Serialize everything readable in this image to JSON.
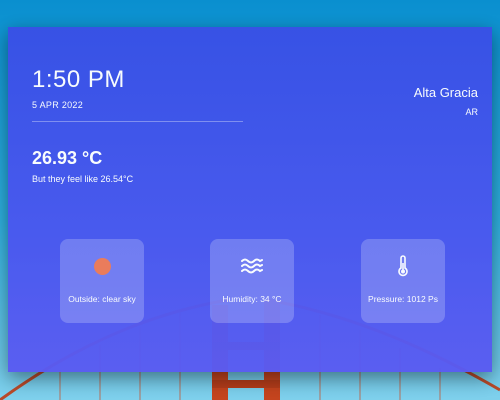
{
  "clock": {
    "time": "1:50 PM",
    "date": "5 APR 2022"
  },
  "location": {
    "city": "Alta Gracia",
    "country": "AR"
  },
  "weather": {
    "temperature": "26.93 °C",
    "feels_like": "But they feel like 26.54°C"
  },
  "tiles": [
    {
      "icon": "sun-icon",
      "label": "Outside: clear sky",
      "color": "#f07b58"
    },
    {
      "icon": "waves-icon",
      "label": "Humidity: 34 °C"
    },
    {
      "icon": "thermometer-icon",
      "label": "Pressure: 1012 Ps"
    }
  ]
}
